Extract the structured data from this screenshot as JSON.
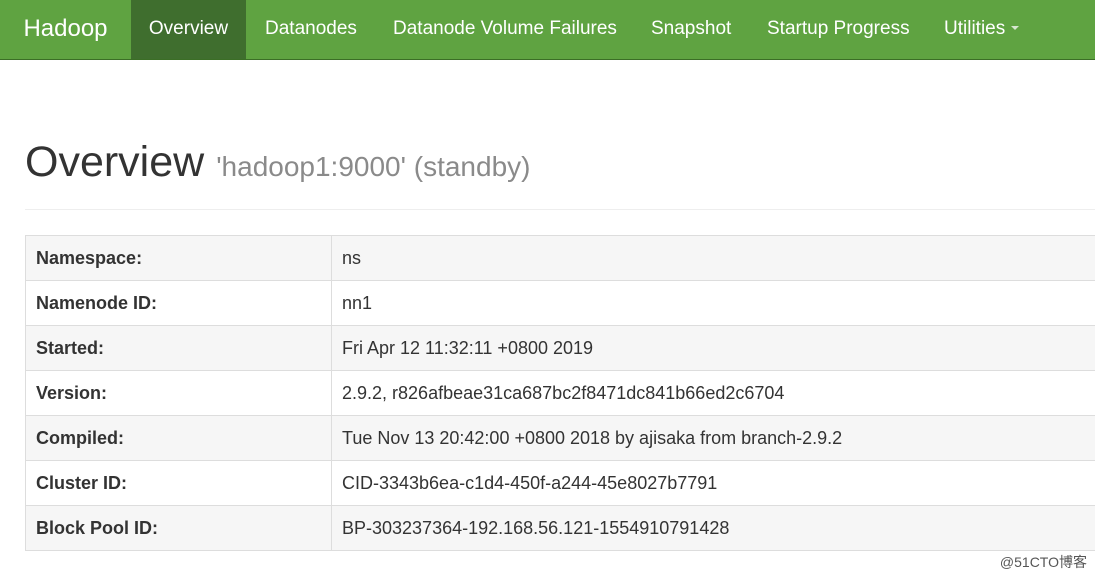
{
  "navbar": {
    "brand": "Hadoop",
    "items": [
      {
        "label": "Overview",
        "active": true
      },
      {
        "label": "Datanodes"
      },
      {
        "label": "Datanode Volume Failures"
      },
      {
        "label": "Snapshot"
      },
      {
        "label": "Startup Progress"
      },
      {
        "label": "Utilities",
        "has_dropdown": true
      }
    ]
  },
  "header": {
    "title": "Overview",
    "subtitle": "'hadoop1:9000' (standby)"
  },
  "overview": {
    "rows": [
      {
        "label": "Namespace:",
        "value": "ns"
      },
      {
        "label": "Namenode ID:",
        "value": "nn1"
      },
      {
        "label": "Started:",
        "value": "Fri Apr 12 11:32:11 +0800 2019"
      },
      {
        "label": "Version:",
        "value": "2.9.2, r826afbeae31ca687bc2f8471dc841b66ed2c6704"
      },
      {
        "label": "Compiled:",
        "value": "Tue Nov 13 20:42:00 +0800 2018 by ajisaka from branch-2.9.2"
      },
      {
        "label": "Cluster ID:",
        "value": "CID-3343b6ea-c1d4-450f-a244-45e8027b7791"
      },
      {
        "label": "Block Pool ID:",
        "value": "BP-303237364-192.168.56.121-1554910791428"
      }
    ]
  },
  "watermark": "@51CTO博客",
  "colors": {
    "navbar": "#5fa341",
    "navbar_active": "#3f6e2e"
  }
}
